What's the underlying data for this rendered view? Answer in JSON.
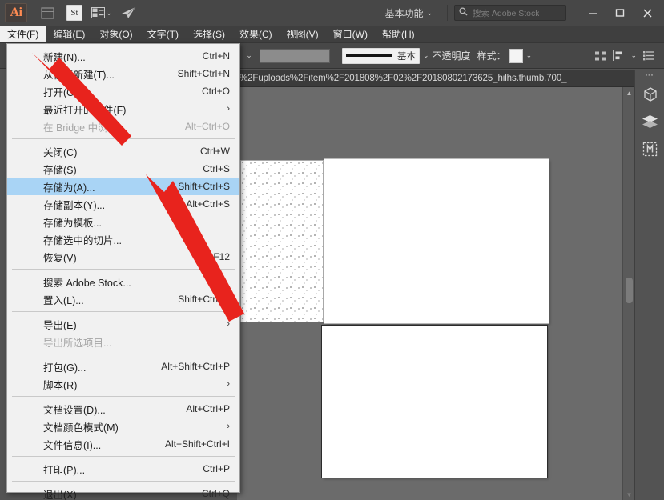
{
  "titlebar": {
    "logo": "Ai",
    "icons": [
      {
        "name": "bridge-icon",
        "glyph": "▦"
      },
      {
        "name": "adobe-stock-icon",
        "glyph": "St"
      },
      {
        "name": "arrange-documents-icon",
        "glyph": "▤"
      },
      {
        "name": "share-behance-icon",
        "glyph": "➤"
      }
    ],
    "workspace_label": "基本功能",
    "workspace_chevron": "⌄",
    "search_placeholder": "搜索 Adobe Stock",
    "search_value": "",
    "search_icon": "search-icon",
    "window_buttons": [
      {
        "name": "minimize-button",
        "glyph": "—"
      },
      {
        "name": "maximize-button",
        "glyph": "▢"
      },
      {
        "name": "close-button",
        "glyph": "✕"
      }
    ]
  },
  "menubar": {
    "items": [
      {
        "label": "文件(F)",
        "active": true
      },
      {
        "label": "编辑(E)",
        "active": false
      },
      {
        "label": "对象(O)",
        "active": false
      },
      {
        "label": "文字(T)",
        "active": false
      },
      {
        "label": "选择(S)",
        "active": false
      },
      {
        "label": "效果(C)",
        "active": false
      },
      {
        "label": "视图(V)",
        "active": false
      },
      {
        "label": "窗口(W)",
        "active": false
      },
      {
        "label": "帮助(H)",
        "active": false
      }
    ]
  },
  "optionsbar": {
    "fill_chevron": "⌄",
    "fill_value": "",
    "stroke_style_label": "基本",
    "stroke_chevron": "⌄",
    "opacity_label": "不透明度",
    "style_label": "样式：",
    "style_chevron": "⌄",
    "icons": [
      {
        "name": "align-objects-icon",
        "glyph": "⠿"
      },
      {
        "name": "distribute-objects-icon",
        "glyph": "⊫"
      },
      {
        "name": "panel-options-icon",
        "glyph": "☰"
      }
    ]
  },
  "document": {
    "path_text": "%2Fuploads%2Fitem%2F201808%2F02%2F20180802173625_hilhs.thumb.700_"
  },
  "canvas": {
    "artboards": [
      {
        "name": "artboard-texture",
        "label": ""
      },
      {
        "name": "artboard-main",
        "label": ""
      },
      {
        "name": "artboard-second",
        "label": ""
      }
    ],
    "scrollbar": {
      "name": "canvas-vertical-scrollbar"
    }
  },
  "dock": {
    "buttons": [
      {
        "name": "properties-panel-icon",
        "glyph": "◳"
      },
      {
        "name": "layers-panel-icon",
        "glyph": "◆"
      },
      {
        "name": "libraries-panel-icon",
        "glyph": "▣"
      }
    ]
  },
  "file_menu": {
    "groups": [
      [
        {
          "label": "新建(N)...",
          "shortcut": "Ctrl+N",
          "state": "highlight-cursor"
        },
        {
          "label": "从模板新建(T)...",
          "shortcut": "Shift+Ctrl+N",
          "state": "normal"
        },
        {
          "label": "打开(O)...",
          "shortcut": "Ctrl+O",
          "state": "normal"
        },
        {
          "label": "最近打开的文件(F)",
          "shortcut": "",
          "submenu": true,
          "state": "normal"
        },
        {
          "label": "在 Bridge 中浏览...",
          "shortcut": "Alt+Ctrl+O",
          "state": "disabled"
        }
      ],
      [
        {
          "label": "关闭(C)",
          "shortcut": "Ctrl+W",
          "state": "normal"
        },
        {
          "label": "存储(S)",
          "shortcut": "Ctrl+S",
          "state": "normal"
        },
        {
          "label": "存储为(A)...",
          "shortcut": "Shift+Ctrl+S",
          "state": "selected"
        },
        {
          "label": "存储副本(Y)...",
          "shortcut": "Alt+Ctrl+S",
          "state": "normal"
        },
        {
          "label": "存储为模板...",
          "shortcut": "",
          "state": "normal"
        },
        {
          "label": "存储选中的切片...",
          "shortcut": "",
          "state": "normal"
        },
        {
          "label": "恢复(V)",
          "shortcut": "F12",
          "state": "normal"
        }
      ],
      [
        {
          "label": "搜索 Adobe Stock...",
          "shortcut": "",
          "state": "normal"
        },
        {
          "label": "置入(L)...",
          "shortcut": "Shift+Ctrl+P",
          "state": "normal"
        }
      ],
      [
        {
          "label": "导出(E)",
          "shortcut": "",
          "submenu": true,
          "state": "normal"
        },
        {
          "label": "导出所选项目...",
          "shortcut": "",
          "state": "disabled"
        }
      ],
      [
        {
          "label": "打包(G)...",
          "shortcut": "Alt+Shift+Ctrl+P",
          "state": "normal"
        },
        {
          "label": "脚本(R)",
          "shortcut": "",
          "submenu": true,
          "state": "normal"
        }
      ],
      [
        {
          "label": "文档设置(D)...",
          "shortcut": "Alt+Ctrl+P",
          "state": "normal"
        },
        {
          "label": "文档颜色模式(M)",
          "shortcut": "",
          "submenu": true,
          "state": "normal"
        },
        {
          "label": "文件信息(I)...",
          "shortcut": "Alt+Shift+Ctrl+I",
          "state": "normal"
        }
      ],
      [
        {
          "label": "打印(P)...",
          "shortcut": "Ctrl+P",
          "state": "normal"
        }
      ],
      [
        {
          "label": "退出(X)",
          "shortcut": "Ctrl+Q",
          "state": "normal"
        }
      ]
    ]
  },
  "annotations": {
    "arrow_color": "#e8231d",
    "arrows": [
      {
        "name": "arrow-pointing-new-file",
        "target": "新建(N)..."
      },
      {
        "name": "arrow-pointing-save-as",
        "target": "存储为(A)..."
      }
    ]
  },
  "colors": {
    "window_chrome": "#474747",
    "menubar": "#3f3f3f",
    "canvas_bg": "#6b6b6b",
    "menu_bg": "#f1f1f1",
    "menu_highlight": "#a9d4f5",
    "accent_red": "#e8231d",
    "logo_orange": "#ff8b52"
  }
}
